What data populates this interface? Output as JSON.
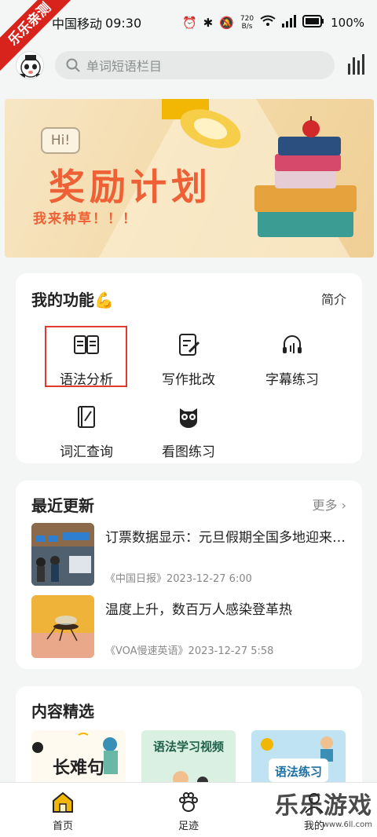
{
  "status_bar": {
    "carrier": "中国移动",
    "time": "09:30",
    "net_speed_value": "720",
    "net_speed_unit": "B/s",
    "battery": "100%",
    "ribbon": "乐乐亲测"
  },
  "header": {
    "search_placeholder": "单词短语栏目"
  },
  "banner": {
    "bubble": "Hi!",
    "title": "奖励计划",
    "subtitle": "我来种草！！！"
  },
  "functions": {
    "title": "我的功能💪",
    "link": "简介",
    "items": [
      {
        "label": "语法分析",
        "icon": "book-open-icon"
      },
      {
        "label": "写作批改",
        "icon": "edit-doc-icon"
      },
      {
        "label": "字幕练习",
        "icon": "headphones-icon"
      },
      {
        "label": "词汇查询",
        "icon": "dictionary-icon"
      },
      {
        "label": "看图练习",
        "icon": "owl-icon"
      }
    ]
  },
  "recent": {
    "title": "最近更新",
    "link": "更多 ›",
    "items": [
      {
        "title": "订票数据显示：元旦假期全国多地迎来出游潮",
        "meta": "《中国日报》2023-12-27 6:00"
      },
      {
        "title": "温度上升，数百万人感染登革热",
        "meta": "《VOA慢速英语》2023-12-27 5:58"
      }
    ]
  },
  "picks": {
    "title": "内容精选",
    "items": [
      {
        "label": "长难句"
      },
      {
        "label": "语法学习视频"
      },
      {
        "label": "语法练习"
      }
    ]
  },
  "bottom_nav": {
    "items": [
      {
        "label": "首页",
        "active": true
      },
      {
        "label": "足迹",
        "active": false
      },
      {
        "label": "我的",
        "active": false
      }
    ]
  },
  "watermark": {
    "main": "乐乐游戏",
    "sub": "www.6ll.com"
  },
  "colors": {
    "accent": "#f2b705",
    "highlight_border": "#e03a2e",
    "banner_title": "#ee6035"
  }
}
